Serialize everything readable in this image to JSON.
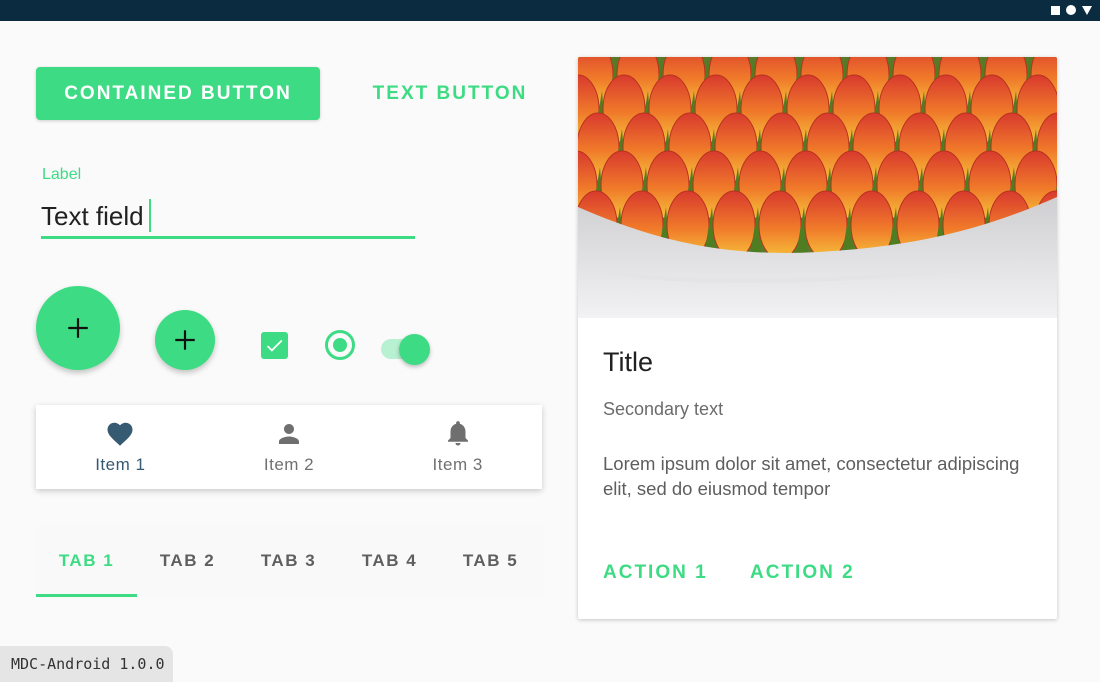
{
  "buttons": {
    "contained_label": "CONTAINED BUTTON",
    "text_label": "TEXT BUTTON"
  },
  "text_field": {
    "label": "Label",
    "value": "Text field"
  },
  "fabs": {
    "large_icon": "plus-icon",
    "small_icon": "plus-icon"
  },
  "controls": {
    "checkbox_checked": true,
    "radio_selected": true,
    "switch_on": true
  },
  "bottom_nav": {
    "items": [
      {
        "label": "Item 1",
        "icon": "heart-icon",
        "active": true
      },
      {
        "label": "Item 2",
        "icon": "person-icon",
        "active": false
      },
      {
        "label": "Item 3",
        "icon": "bell-icon",
        "active": false
      }
    ]
  },
  "tabs": {
    "items": [
      "TAB 1",
      "TAB 2",
      "TAB 3",
      "TAB 4",
      "TAB 5"
    ],
    "active_index": 0
  },
  "card": {
    "image": "tulips-photo",
    "title": "Title",
    "secondary": "Secondary text",
    "body": "Lorem ipsum dolor sit amet, consectetur adipiscing elit, sed do eiusmod tempor",
    "actions": [
      "ACTION 1",
      "ACTION 2"
    ]
  },
  "footer": {
    "version": "MDC-Android 1.0.0"
  },
  "colors": {
    "accent": "#3ddc84",
    "status_bar": "#0b2c40",
    "nav_active": "#375a73"
  }
}
